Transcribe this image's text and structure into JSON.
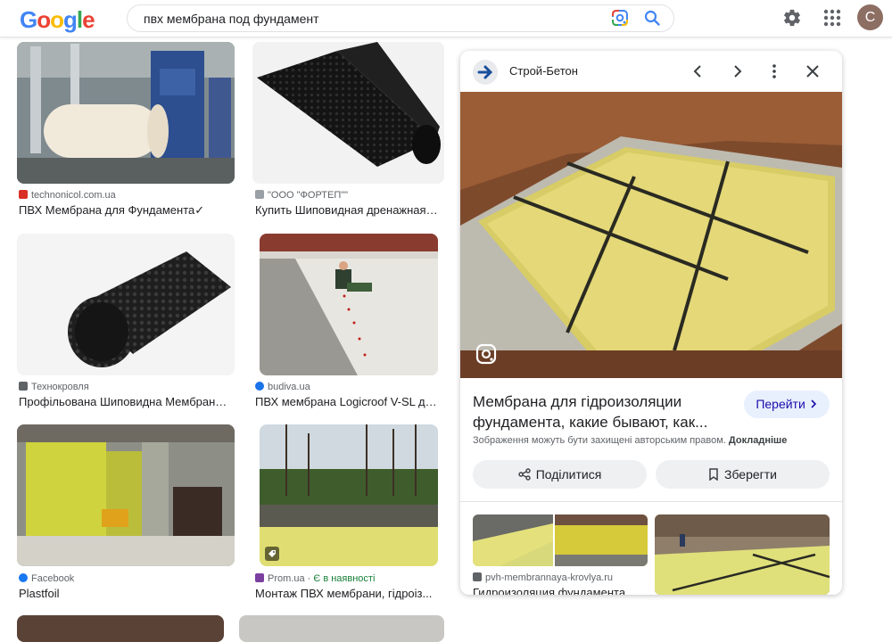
{
  "header": {
    "logo_letters": [
      {
        "ch": "G",
        "color": "#4285F4"
      },
      {
        "ch": "o",
        "color": "#EA4335"
      },
      {
        "ch": "o",
        "color": "#FBBC05"
      },
      {
        "ch": "g",
        "color": "#4285F4"
      },
      {
        "ch": "l",
        "color": "#34A853"
      },
      {
        "ch": "e",
        "color": "#EA4335"
      }
    ],
    "search_query": "пвх мембрана под фундамент",
    "avatar_letter": "C"
  },
  "results": [
    {
      "source": "technonicol.com.ua",
      "title": "ПВХ Мембрана для Фундамента✓",
      "fav_color": "#d93025",
      "thumb": "factory"
    },
    {
      "source": "\"ООО \"ФОРТЕП\"\"",
      "title": "Купить Шиповидная дренажная ...",
      "fav_color": "#9aa0a6",
      "thumb": "black-roll"
    },
    {
      "source": "Технокровля",
      "title": "Профільована Шиповидна Мембрана ...",
      "fav_color": "#5f6368",
      "thumb": "dimple-roll"
    },
    {
      "source": "budiva.ua",
      "title": "ПВХ мембрана Logicroof V-SL дл...",
      "fav_color": "#1a73e8",
      "thumb": "worker"
    },
    {
      "source": "Facebook",
      "title": "Plastfoil",
      "fav_color": "#1877f2",
      "thumb": "basement"
    },
    {
      "source": "Prom.ua",
      "source_extra": "Є в наявності",
      "title": "Монтаж ПВХ мембрани, гідроіз...",
      "fav_color": "#7b3fa0",
      "thumb": "pit"
    }
  ],
  "panel": {
    "site_name": "Строй-Бетон",
    "title": "Мембрана для гідроизоляции фундамента, какие бывают, как...",
    "goto_label": "Перейти",
    "copyright": "Зображення можуть бути захищені авторським правом.",
    "learn_more": "Докладніше",
    "share_label": "Поділитися",
    "save_label": "Зберегти",
    "related_source": "pvh-membrannaya-krovlya.ru",
    "related_title": "Гидроизоляция фундамента"
  }
}
